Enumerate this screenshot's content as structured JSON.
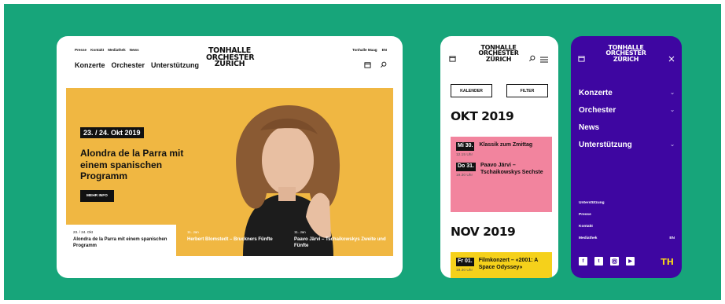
{
  "logo": {
    "line1": "TONHALLE",
    "line2": "ORCHESTER",
    "line3": "ZÜRICH"
  },
  "tablet": {
    "util_nav": [
      "Presse",
      "Kontakt",
      "Mediathek",
      "News"
    ],
    "main_nav": [
      "Konzerte",
      "Orchester",
      "Unterstützung"
    ],
    "right_links": [
      "Tonhalle Maag",
      "EN"
    ],
    "hero": {
      "date": "23. / 24. Okt 2019",
      "title": "Alondra de la Parra mit einem spanischen Programm",
      "button": "MEHR INFO"
    },
    "cards": [
      {
        "date": "23. / 24. Okt",
        "title": "Alondra de la Parra mit einem spanischen Programm"
      },
      {
        "date": "11. Jan",
        "title": "Herbert Blomstedt – Bruckners Fünfte"
      },
      {
        "date": "11. Jan",
        "title": "Paavo Järvi – Tschaikowskys Zweite und Fünfte"
      }
    ]
  },
  "phone1": {
    "buttons": [
      "KALENDER",
      "FILTER"
    ],
    "months": [
      {
        "label": "OKT 2019",
        "color": "#f2849e",
        "events": [
          {
            "day": "Mi 30.",
            "time": "12.15 Uhr",
            "title": "Klassik zum Zmittag"
          },
          {
            "day": "Do 31.",
            "time": "19.30 Uhr",
            "title": "Paavo Järvi – Tschaikowskys Sechste"
          }
        ]
      },
      {
        "label": "NOV 2019",
        "color": "#f5d11b",
        "events": [
          {
            "day": "Fr 01.",
            "time": "19.30 Uhr",
            "title": "Filmkonzert – «2001: A Space Odyssey»"
          }
        ]
      }
    ]
  },
  "phone2": {
    "nav": [
      "Konzerte",
      "Orchester",
      "News",
      "Unterstützung"
    ],
    "links": [
      "Unterstützung",
      "Presse",
      "Kontakt",
      "Mediathek"
    ],
    "lang": "EN",
    "social": [
      "facebook-icon",
      "twitter-icon",
      "instagram-icon",
      "youtube-icon"
    ],
    "brand_mark": "TH"
  },
  "colors": {
    "background": "#17a57a",
    "hero": "#f0b742",
    "pink": "#f2849e",
    "yellow": "#f5d11b",
    "purple": "#3e06a1"
  }
}
